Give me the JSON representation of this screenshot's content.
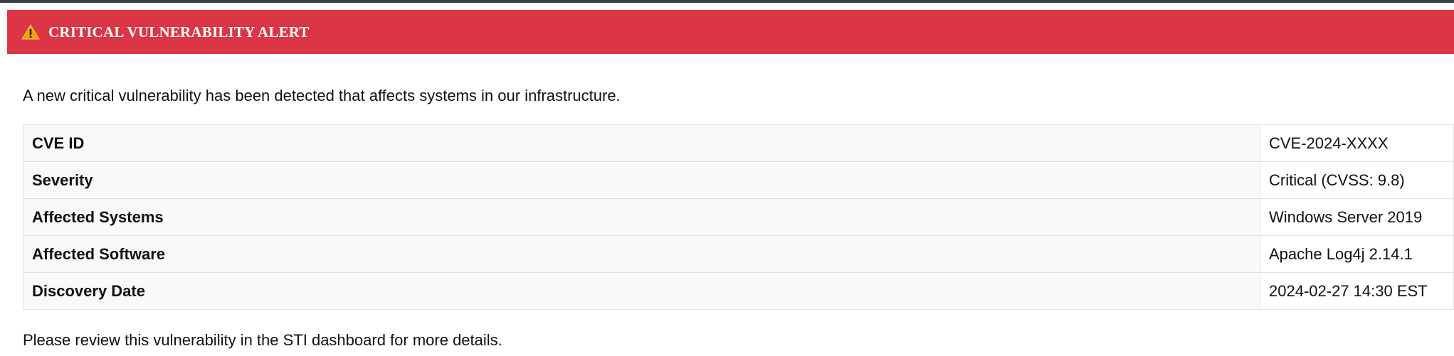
{
  "colors": {
    "banner_background": "#dc3545",
    "banner_text": "#ffffff",
    "warning_icon": "#f0a30a",
    "table_border": "#dee2e6",
    "key_cell_background": "#f8f9fa"
  },
  "alert": {
    "icon": "warning-triangle-icon",
    "title": "CRITICAL VULNERABILITY ALERT",
    "intro": "A new critical vulnerability has been detected that affects systems in our infrastructure.",
    "details": [
      {
        "label": "CVE ID",
        "value": "CVE-2024-XXXX"
      },
      {
        "label": "Severity",
        "value": "Critical (CVSS: 9.8)"
      },
      {
        "label": "Affected Systems",
        "value": "Windows Server 2019"
      },
      {
        "label": "Affected Software",
        "value": "Apache Log4j 2.14.1"
      },
      {
        "label": "Discovery Date",
        "value": "2024-02-27 14:30 EST"
      }
    ],
    "footer": "Please review this vulnerability in the STI dashboard for more details."
  }
}
